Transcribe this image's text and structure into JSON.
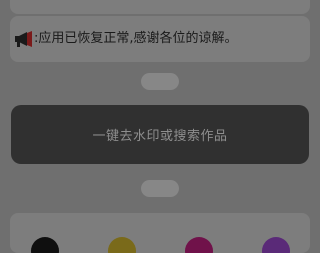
{
  "notice": {
    "icon": "megaphone-icon",
    "text": ":应用已恢复正常,感谢各位的谅解。"
  },
  "search": {
    "label": "一键去水印或搜索作品"
  },
  "apps": [
    {
      "icon": "app-icon-black",
      "color": "#0f0f0f"
    },
    {
      "icon": "app-icon-gold",
      "color": "#7a6a1a"
    },
    {
      "icon": "app-icon-magenta",
      "color": "#70124a"
    },
    {
      "icon": "app-icon-purple",
      "color": "#5a2a78"
    }
  ]
}
